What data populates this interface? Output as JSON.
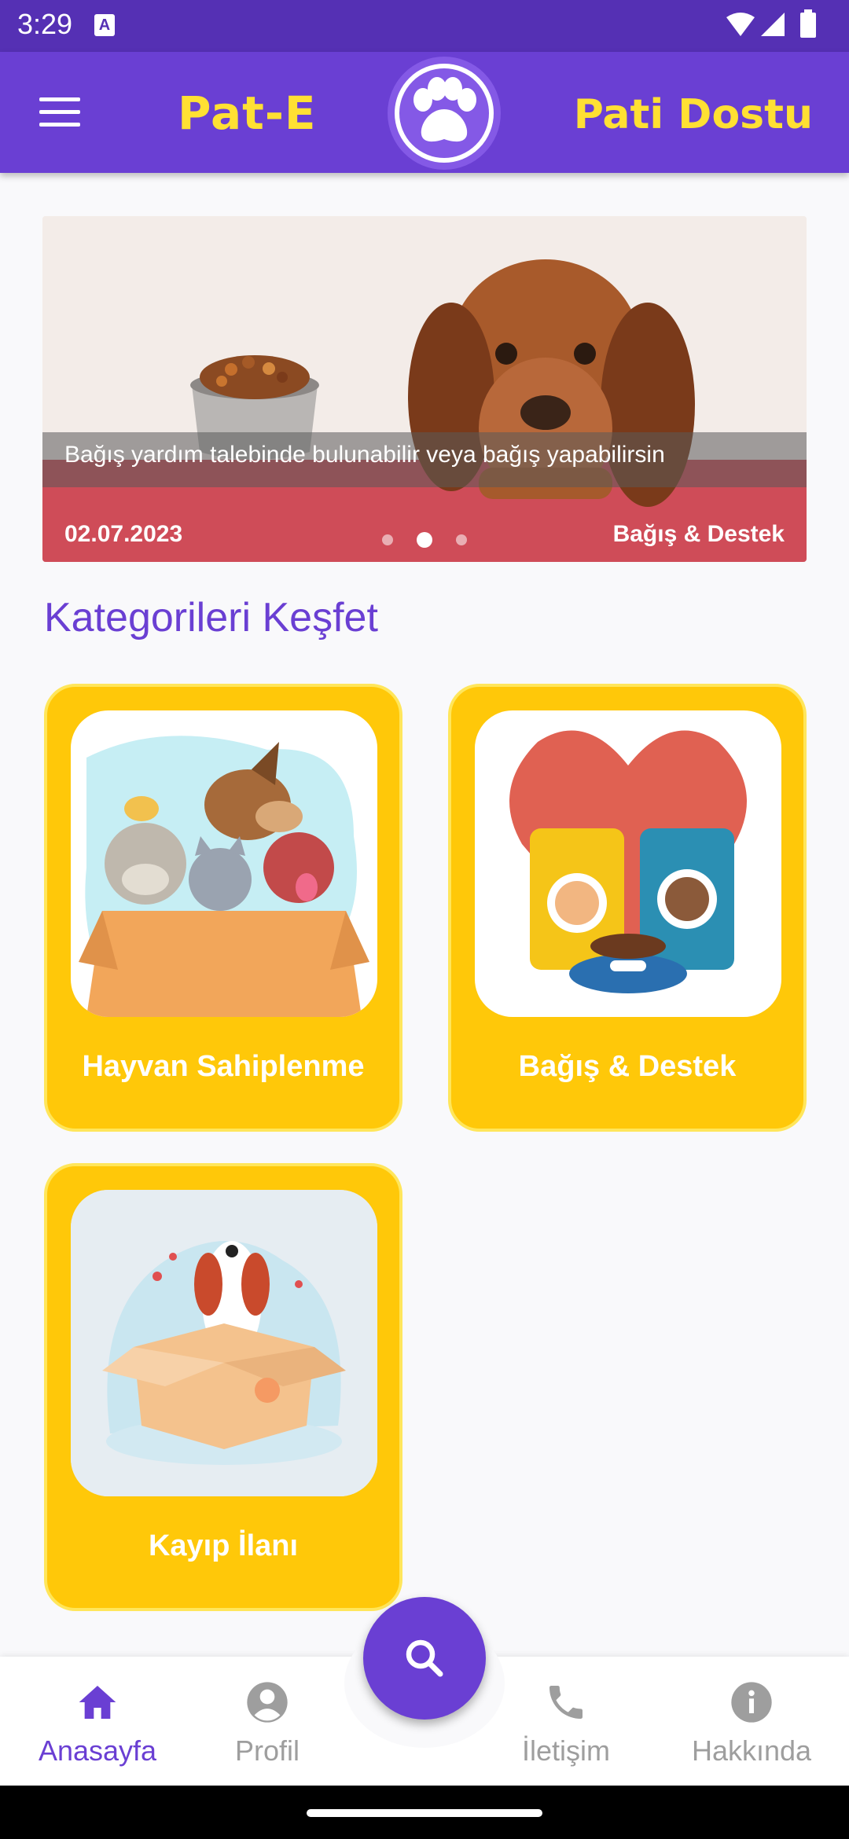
{
  "status": {
    "time": "3:29",
    "notif_badge": "A"
  },
  "app_bar": {
    "left_title": "Pat-E",
    "right_title": "Pati Dostu"
  },
  "carousel": {
    "caption": "Bağış yardım talebinde bulunabilir veya bağış yapabilirsin",
    "date": "02.07.2023",
    "tag": "Bağış & Destek",
    "active_slide": 2,
    "slide_count": 3
  },
  "section": {
    "title": "Kategorileri Keşfet"
  },
  "categories": [
    {
      "label": "Hayvan Sahiplenme",
      "icon": "pets-in-box-illustration"
    },
    {
      "label": "Bağış & Destek",
      "icon": "pet-food-donation-illustration"
    },
    {
      "label": "Kayıp İlanı",
      "icon": "lost-dog-box-illustration"
    }
  ],
  "bottom_nav": {
    "items": [
      {
        "label": "Anasayfa",
        "icon": "home-icon",
        "active": true
      },
      {
        "label": "Profil",
        "icon": "profile-icon",
        "active": false
      },
      {
        "label": "İletişim",
        "icon": "phone-icon",
        "active": false
      },
      {
        "label": "Hakkında",
        "icon": "info-icon",
        "active": false
      }
    ],
    "fab_icon": "search-icon"
  },
  "colors": {
    "primary": "#6a3fd3",
    "status_bar": "#5530b4",
    "accent_yellow": "#ffe033",
    "card_bg": "#ffc809",
    "inactive": "#9e9e9e"
  }
}
